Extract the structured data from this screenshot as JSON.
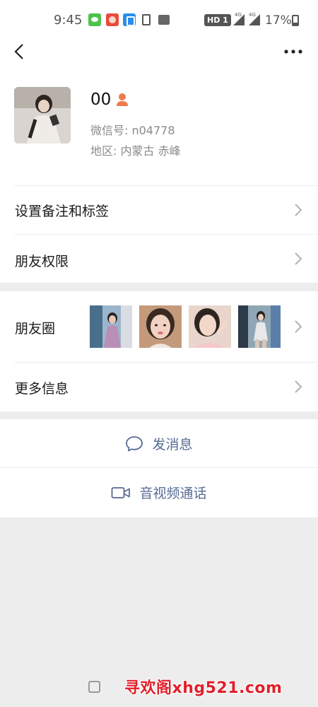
{
  "status_bar": {
    "time": "9:45",
    "network_badge": "HD 1",
    "signal_label_1": "4G",
    "signal_label_2": "4G",
    "battery": "17%",
    "notification_icons": [
      "wechat-icon",
      "cartoon-app-icon",
      "network-app-icon",
      "sim-icon",
      "image-icon"
    ]
  },
  "header": {
    "back_icon": "chevron-left-icon",
    "more_icon": "more-dots-icon"
  },
  "profile": {
    "name": "00",
    "gender_icon": "female-icon",
    "wechat_id": "微信号: n04778",
    "region": "地区: 内蒙古 赤峰"
  },
  "menu": {
    "remark_tags": "设置备注和标签",
    "permissions": "朋友权限",
    "moments": "朋友圈",
    "more_info": "更多信息"
  },
  "actions": {
    "send_message": "发消息",
    "video_call": "音视频通话"
  },
  "watermark": "寻欢阁xhg521.com",
  "colors": {
    "link_blue": "#576b95",
    "background": "#ededed",
    "gender_orange": "#f07a4c",
    "watermark_red": "#e0202b"
  }
}
